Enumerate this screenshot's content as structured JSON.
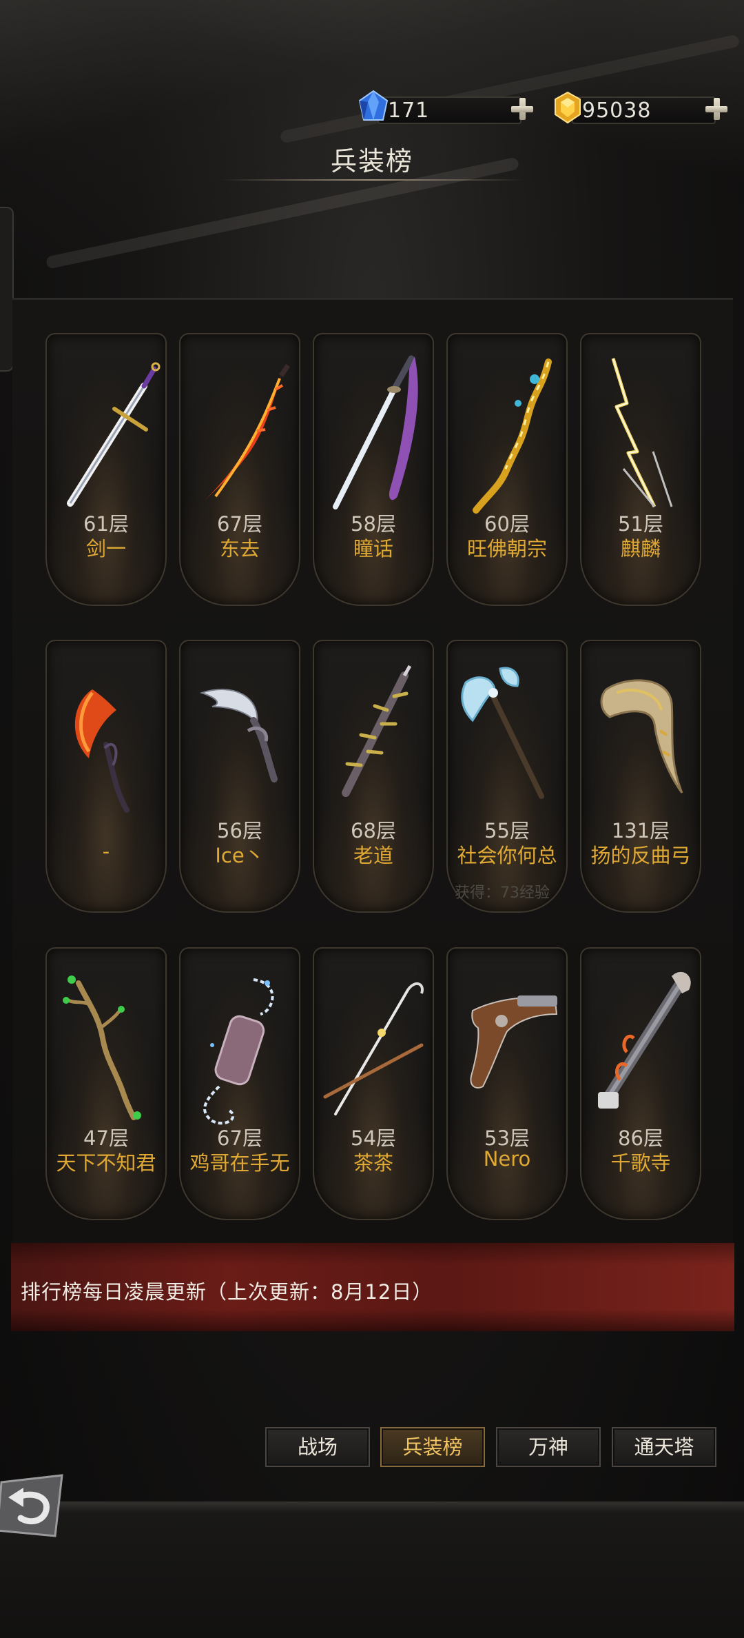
{
  "currency": {
    "gems": "171",
    "gold": "95038"
  },
  "header": {
    "title": "兵装榜"
  },
  "cards": [
    {
      "floor": "61层",
      "name": "剑一",
      "weapon": "sword-icon"
    },
    {
      "floor": "67层",
      "name": "东去",
      "weapon": "flame-blade-icon"
    },
    {
      "floor": "58层",
      "name": "瞳话",
      "weapon": "katana-icon"
    },
    {
      "floor": "60层",
      "name": "旺佛朝宗",
      "weapon": "golden-spear-icon"
    },
    {
      "floor": "51层",
      "name": "麒麟",
      "weapon": "lightning-spear-icon"
    },
    {
      "floor": "",
      "name": "-",
      "weapon": "fire-scythe-icon"
    },
    {
      "floor": "56层",
      "name": "Ice丶",
      "weapon": "curved-dagger-icon"
    },
    {
      "floor": "68层",
      "name": "老道",
      "weapon": "spiked-blade-icon"
    },
    {
      "floor": "55层",
      "name": "社会你何总",
      "weapon": "battle-axe-icon"
    },
    {
      "floor": "131层",
      "name": "扬的反曲弓",
      "weapon": "horn-bow-icon"
    },
    {
      "floor": "47层",
      "name": "天下不知君",
      "weapon": "branch-staff-icon"
    },
    {
      "floor": "67层",
      "name": "鸡哥在手无",
      "weapon": "chain-gauntlet-icon"
    },
    {
      "floor": "54层",
      "name": "茶茶",
      "weapon": "crossed-staves-icon"
    },
    {
      "floor": "53层",
      "name": "Nero",
      "weapon": "flintlock-pistol-icon"
    },
    {
      "floor": "86层",
      "name": "千歌寺",
      "weapon": "blunderbuss-axe-icon"
    }
  ],
  "reward_text": "获得：73经验",
  "banner": {
    "text": "排行榜每日凌晨更新（上次更新：8月12日）"
  },
  "tabs": [
    {
      "label": "战场",
      "active": false
    },
    {
      "label": "兵装榜",
      "active": true
    },
    {
      "label": "万神",
      "active": false
    },
    {
      "label": "通天塔",
      "active": false
    }
  ],
  "colors": {
    "accent_gold": "#e0a933",
    "banner_red": "#6a1c17",
    "active_tab_text": "#f3c462"
  }
}
